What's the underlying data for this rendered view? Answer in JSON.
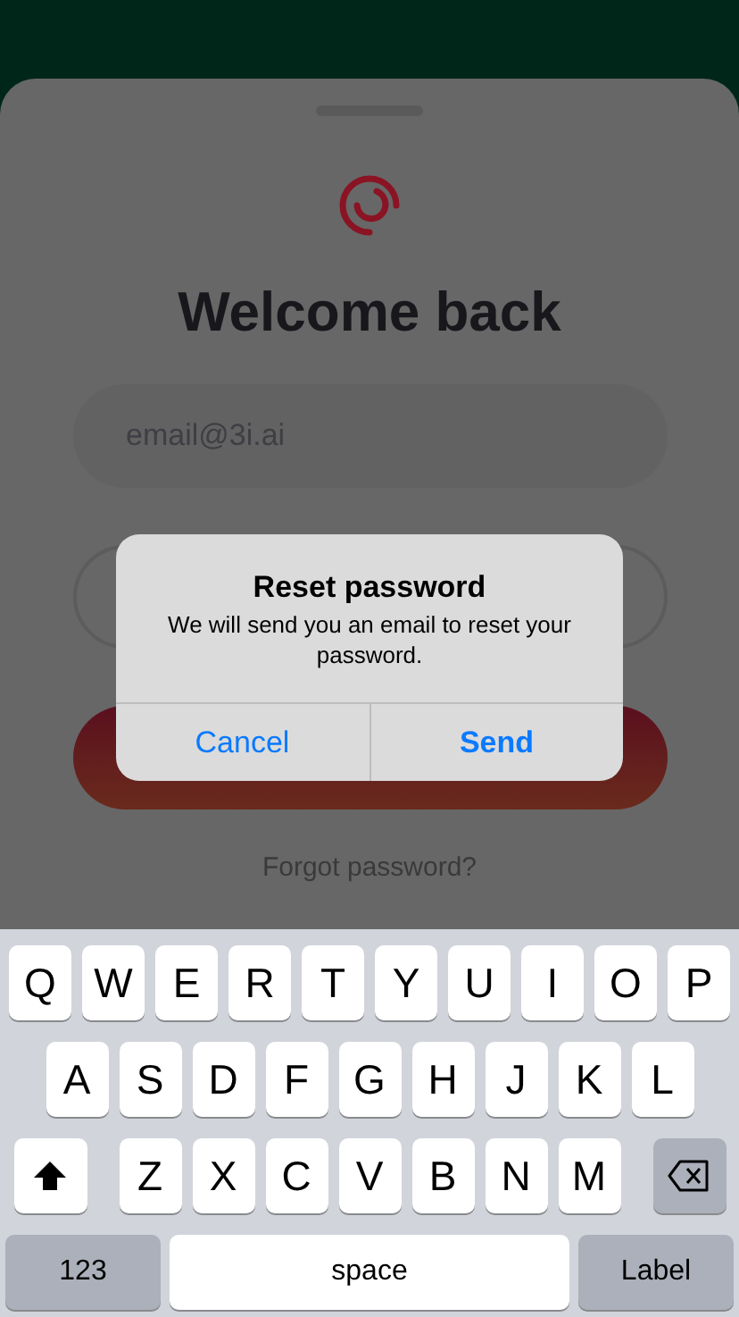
{
  "login": {
    "title": "Welcome back",
    "email": {
      "value": "email@3i.ai"
    },
    "forgot_link": "Forgot password?"
  },
  "dialog": {
    "title": "Reset password",
    "message": "We will send you an email to reset your password.",
    "buttons": [
      {
        "label": "Cancel",
        "bold": false
      },
      {
        "label": "Send",
        "bold": true
      }
    ]
  },
  "keyboard": {
    "rows": [
      [
        {
          "kind": "char",
          "label": "Q"
        },
        {
          "kind": "char",
          "label": "W"
        },
        {
          "kind": "char",
          "label": "E"
        },
        {
          "kind": "char",
          "label": "R"
        },
        {
          "kind": "char",
          "label": "T"
        },
        {
          "kind": "char",
          "label": "Y"
        },
        {
          "kind": "char",
          "label": "U"
        },
        {
          "kind": "char",
          "label": "I"
        },
        {
          "kind": "char",
          "label": "O"
        },
        {
          "kind": "char",
          "label": "P"
        }
      ],
      [
        {
          "kind": "char",
          "label": "A"
        },
        {
          "kind": "char",
          "label": "S"
        },
        {
          "kind": "char",
          "label": "D"
        },
        {
          "kind": "char",
          "label": "F"
        },
        {
          "kind": "char",
          "label": "G"
        },
        {
          "kind": "char",
          "label": "H"
        },
        {
          "kind": "char",
          "label": "J"
        },
        {
          "kind": "char",
          "label": "K"
        },
        {
          "kind": "char",
          "label": "L"
        }
      ],
      [
        {
          "kind": "shift"
        },
        {
          "kind": "char",
          "label": "Z"
        },
        {
          "kind": "char",
          "label": "X"
        },
        {
          "kind": "char",
          "label": "C"
        },
        {
          "kind": "char",
          "label": "V"
        },
        {
          "kind": "char",
          "label": "B"
        },
        {
          "kind": "char",
          "label": "N"
        },
        {
          "kind": "char",
          "label": "M"
        },
        {
          "kind": "delete"
        }
      ]
    ],
    "bottom_row": {
      "numbers_key": "123",
      "space_key": "space",
      "return_key": "Label"
    }
  }
}
